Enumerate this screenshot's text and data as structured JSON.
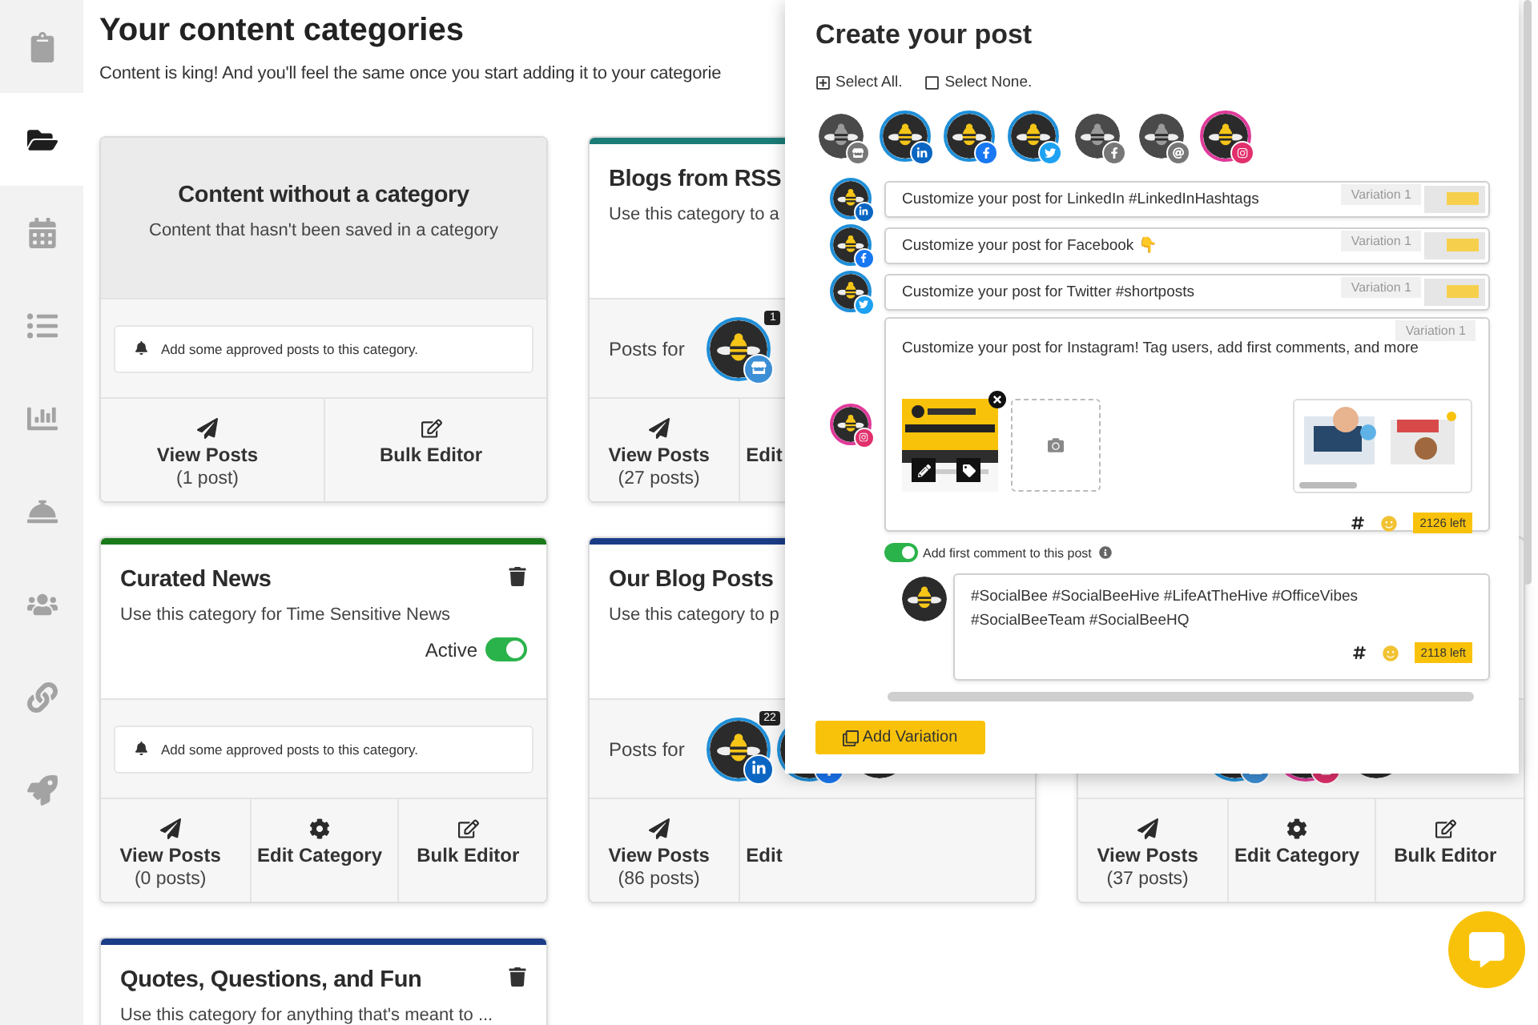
{
  "sidebar": {
    "items": [
      {
        "selected": false
      },
      {
        "selected": true
      },
      {
        "selected": false
      },
      {
        "selected": false
      },
      {
        "selected": false
      },
      {
        "selected": false
      },
      {
        "selected": false
      },
      {
        "selected": false
      },
      {
        "selected": false
      }
    ]
  },
  "page": {
    "title": "Your content categories",
    "subtitle": "Content is king! And you'll feel the same once you start adding it to your categorie"
  },
  "rows": [
    [
      {
        "kind": "uncategorized",
        "title": "Content without a category",
        "description": "Content that hasn't been saved in a category",
        "notice": "Add some approved posts to this category.",
        "actions": [
          {
            "kind": "view",
            "label": "View Posts",
            "count": "(1 post)"
          },
          {
            "kind": "bulk",
            "label": "Bulk Editor"
          }
        ]
      },
      {
        "kind": "category",
        "color": "#1c7c78",
        "title": "Blogs from RSS",
        "description": "Use this category to a",
        "posts_label": "Posts for",
        "profiles": [
          {
            "kind": "google",
            "count": "1"
          }
        ],
        "actions": [
          {
            "kind": "view",
            "label": "View Posts",
            "count": "(27 posts)"
          },
          {
            "kind": "edit",
            "label": "Edit"
          }
        ]
      }
    ],
    [
      {
        "kind": "category",
        "color": "#1a7a1a",
        "title": "Curated News",
        "description": "Use this category for Time Sensitive News",
        "deletable": true,
        "active": {
          "label": "Active",
          "on": true
        },
        "notice": "Add some approved posts to this category.",
        "actions": [
          {
            "kind": "view",
            "label": "View Posts",
            "count": "(0 posts)"
          },
          {
            "kind": "edit",
            "label": "Edit Category"
          },
          {
            "kind": "bulk",
            "label": "Bulk Editor"
          }
        ]
      },
      {
        "kind": "category",
        "color": "#1b3c87",
        "title": "Our Blog Posts",
        "description": "Use this category to p",
        "posts_label": "Posts for",
        "profiles": [
          {
            "kind": "linkedin",
            "count": "22"
          },
          {
            "kind": "facebook"
          },
          {
            "kind": "plain"
          }
        ],
        "actions": [
          {
            "kind": "view",
            "label": "View Posts",
            "count": "(86 posts)"
          },
          {
            "kind": "edit",
            "label": "Edit"
          }
        ]
      },
      {
        "kind": "category",
        "profiles": [
          {
            "kind": "google"
          },
          {
            "kind": "instagram"
          },
          {
            "kind": "plain"
          }
        ],
        "actions": [
          {
            "kind": "view",
            "label": "View Posts",
            "count": "(37 posts)"
          },
          {
            "kind": "edit",
            "label": "Edit Category"
          },
          {
            "kind": "bulk",
            "label": "Bulk Editor"
          }
        ]
      }
    ],
    [
      {
        "kind": "category",
        "color": "#1b3c87",
        "title": "Quotes, Questions, and Fun",
        "description": "Use this category for anything that's meant to ...",
        "deletable": true
      }
    ]
  ],
  "composer": {
    "title": "Create your post",
    "select_all": "Select All.",
    "select_none": "Select None.",
    "profiles": [
      {
        "kind": "google",
        "selected": false
      },
      {
        "kind": "linkedin",
        "selected": true
      },
      {
        "kind": "facebook",
        "selected": true
      },
      {
        "kind": "twitter",
        "selected": true
      },
      {
        "kind": "facebook",
        "selected": false
      },
      {
        "kind": "threads",
        "selected": false
      },
      {
        "kind": "instagram",
        "selected": true
      }
    ],
    "variations": [
      {
        "kind": "linkedin",
        "text": "Customize your post for LinkedIn #LinkedInHashtags",
        "tag": "Variation 1"
      },
      {
        "kind": "facebook",
        "text": "Customize your post for Facebook 👇",
        "tag": "Variation 1"
      },
      {
        "kind": "twitter",
        "text": "Customize your post for Twitter #shortposts",
        "tag": "Variation 1"
      }
    ],
    "instagram": {
      "kind": "instagram",
      "text": "Customize your post for Instagram! Tag users, add first comments, and more",
      "tag": "Variation 1",
      "counter": "2126 left"
    },
    "first_comment": {
      "label": "Add first comment to this post",
      "on": true,
      "text": "#SocialBee #SocialBeeHive #LifeAtTheHive #OfficeVibes #SocialBeeTeam #SocialBeeHQ",
      "counter": "2118 left"
    },
    "add_button": "Add Variation"
  }
}
